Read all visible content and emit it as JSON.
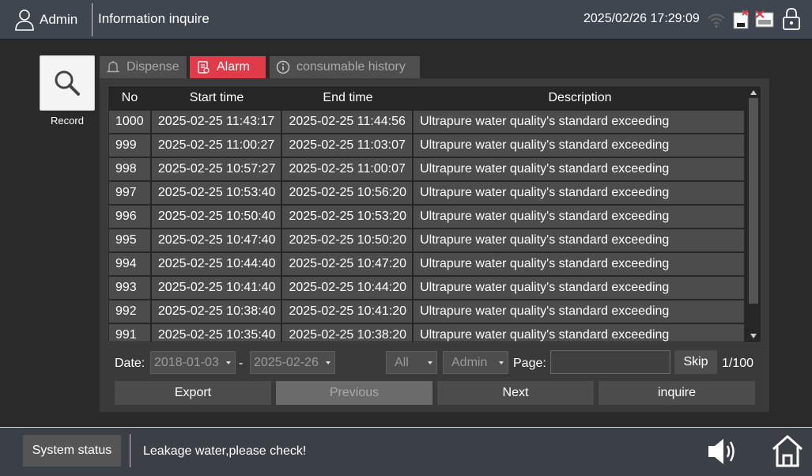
{
  "header": {
    "user": "Admin",
    "title": "Information inquire",
    "datetime": "2025/02/26 17:29:09"
  },
  "sidebar": {
    "record_label": "Record"
  },
  "tabs": [
    {
      "label": "Dispense",
      "icon": "bell-icon",
      "active": false
    },
    {
      "label": "Alarm",
      "icon": "alarm-log-icon",
      "active": true
    },
    {
      "label": "consumable history",
      "icon": "info-icon",
      "active": false
    }
  ],
  "table": {
    "columns": [
      "No",
      "Start time",
      "End time",
      "Description"
    ],
    "rows": [
      [
        "1000",
        "2025-02-25 11:43:17",
        "2025-02-25 11:44:56",
        "Ultrapure water quality's standard exceeding"
      ],
      [
        "999",
        "2025-02-25 11:00:27",
        "2025-02-25 11:03:07",
        "Ultrapure water quality's standard exceeding"
      ],
      [
        "998",
        "2025-02-25 10:57:27",
        "2025-02-25 11:00:07",
        "Ultrapure water quality's standard exceeding"
      ],
      [
        "997",
        "2025-02-25 10:53:40",
        "2025-02-25 10:56:20",
        "Ultrapure water quality's standard exceeding"
      ],
      [
        "996",
        "2025-02-25 10:50:40",
        "2025-02-25 10:53:20",
        "Ultrapure water quality's standard exceeding"
      ],
      [
        "995",
        "2025-02-25 10:47:40",
        "2025-02-25 10:50:20",
        "Ultrapure water quality's standard exceeding"
      ],
      [
        "994",
        "2025-02-25 10:44:40",
        "2025-02-25 10:47:20",
        "Ultrapure water quality's standard exceeding"
      ],
      [
        "993",
        "2025-02-25 10:41:40",
        "2025-02-25 10:44:20",
        "Ultrapure water quality's standard exceeding"
      ],
      [
        "992",
        "2025-02-25 10:38:40",
        "2025-02-25 10:41:20",
        "Ultrapure water quality's standard exceeding"
      ],
      [
        "991",
        "2025-02-25 10:35:40",
        "2025-02-25 10:38:20",
        "Ultrapure water quality's standard exceeding"
      ]
    ]
  },
  "filters": {
    "date_label": "Date:",
    "date_from": "2018-01-03",
    "date_sep": "-",
    "date_to": "2025-02-26",
    "type_select": "All",
    "user_select": "Admin",
    "page_label": "Page:",
    "page_input_value": "",
    "skip_label": "Skip",
    "page_indicator": "1/100"
  },
  "actions": {
    "export": "Export",
    "previous": "Previous",
    "next": "Next",
    "inquire": "inquire"
  },
  "footer": {
    "system_status": "System status",
    "message": "Leakage water,please check!"
  },
  "colors": {
    "accent": "#e13a48",
    "topbar": "#3f4650",
    "background": "#2a2a2a"
  }
}
